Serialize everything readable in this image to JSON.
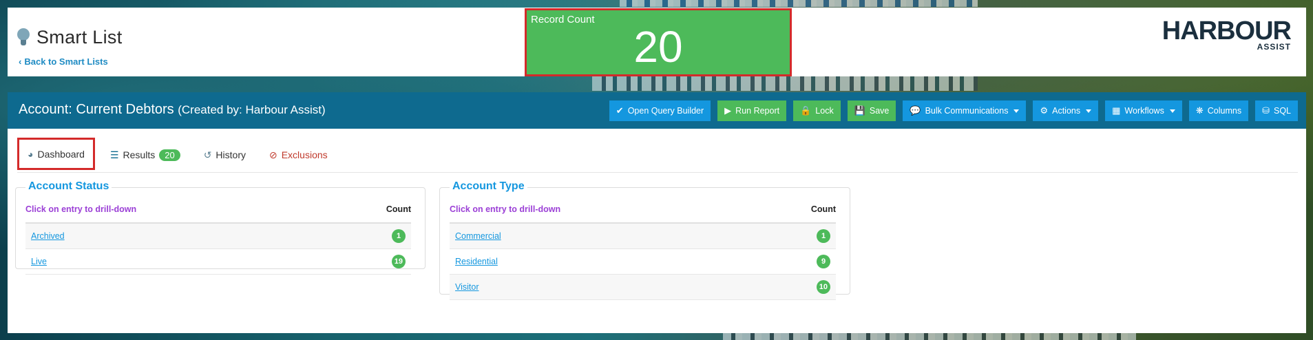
{
  "header": {
    "title": "Smart List",
    "back_label": "Back to Smart Lists",
    "record_count": {
      "label": "Record Count",
      "value": "20"
    },
    "logo": {
      "main": "HARBOUR",
      "sub": "ASSIST"
    }
  },
  "panel": {
    "title": "Account: Current Debtors",
    "created_by": "(Created by: Harbour Assist)"
  },
  "toolbar": {
    "open_query_builder": "Open Query Builder",
    "run_report": "Run Report",
    "lock": "Lock",
    "save": "Save",
    "bulk_communications": "Bulk Communications",
    "actions": "Actions",
    "workflows": "Workflows",
    "columns": "Columns",
    "sql": "SQL"
  },
  "tabs": {
    "dashboard": "Dashboard",
    "results": "Results",
    "results_count": "20",
    "history": "History",
    "exclusions": "Exclusions"
  },
  "account_status": {
    "title": "Account Status",
    "hint": "Click on entry to drill-down",
    "count_header": "Count",
    "rows": [
      {
        "label": "Archived",
        "count": "1"
      },
      {
        "label": "Live",
        "count": "19"
      }
    ]
  },
  "account_type": {
    "title": "Account Type",
    "hint": "Click on entry to drill-down",
    "count_header": "Count",
    "rows": [
      {
        "label": "Commercial",
        "count": "1"
      },
      {
        "label": "Residential",
        "count": "9"
      },
      {
        "label": "Visitor",
        "count": "10"
      }
    ]
  },
  "colors": {
    "header_bar": "#0e6a8f",
    "button_blue": "#1497df",
    "button_green": "#4dba5a",
    "highlight_red": "#d42a2a",
    "hint_purple": "#9b3fd6"
  }
}
